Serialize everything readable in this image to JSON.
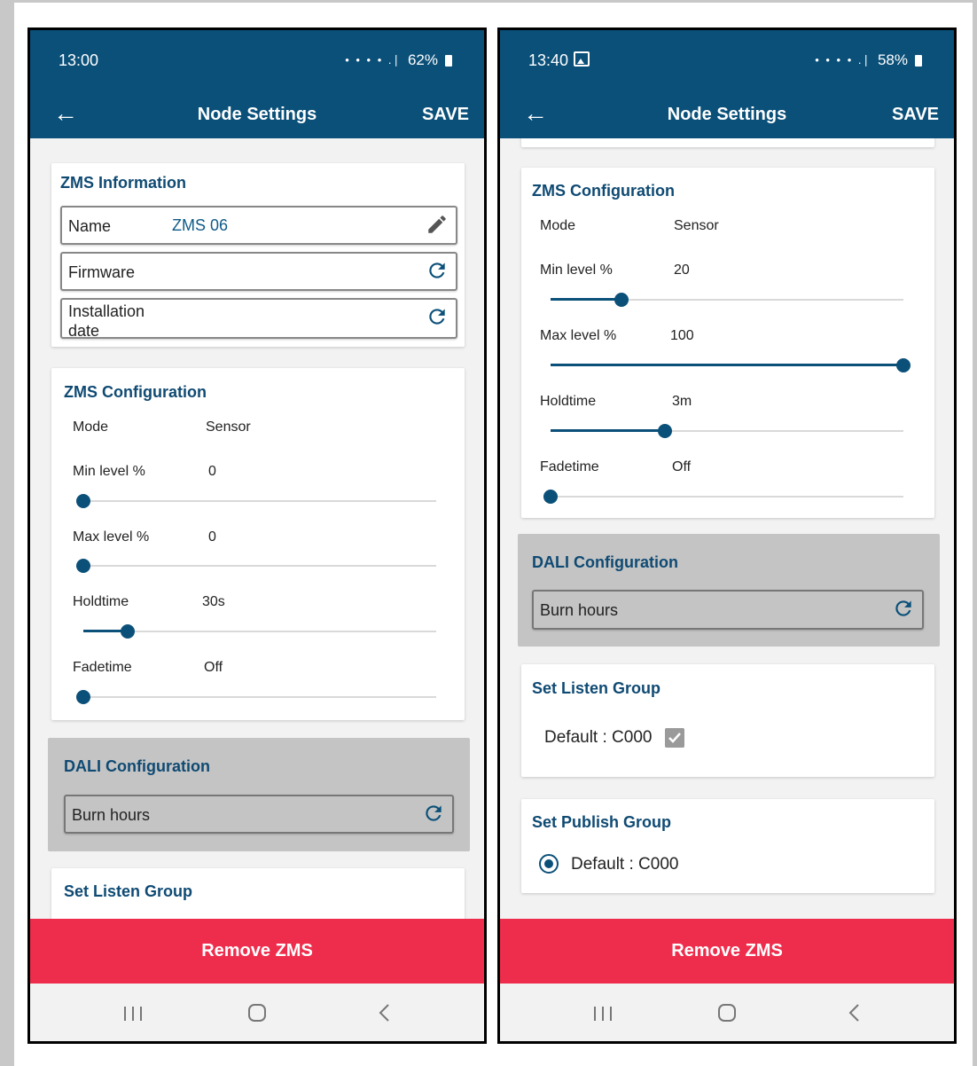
{
  "left": {
    "status": {
      "time": "13:00",
      "battery": "62%",
      "icons": "• • • • .∣"
    },
    "appbar": {
      "title": "Node Settings",
      "save": "SAVE"
    },
    "info": {
      "title": "ZMS Information",
      "name_label": "Name",
      "name_value": "ZMS 06",
      "firmware_label": "Firmware",
      "install_label_1": "Installation",
      "install_label_2": "date"
    },
    "config": {
      "title": "ZMS Configuration",
      "mode_label": "Mode",
      "mode_value": "Sensor",
      "min_label": "Min level %",
      "min_value": "0",
      "min_fraction": 0,
      "max_label": "Max level %",
      "max_value": "0",
      "max_fraction": 0,
      "hold_label": "Holdtime",
      "hold_value": "30s",
      "hold_fraction": 0.125,
      "fade_label": "Fadetime",
      "fade_value": "Off",
      "fade_fraction": 0
    },
    "dali": {
      "title": "DALI Configuration",
      "burn_label": "Burn hours"
    },
    "listen": {
      "title": "Set Listen Group"
    },
    "remove": "Remove ZMS"
  },
  "right": {
    "status": {
      "time": "13:40",
      "battery": "58%",
      "icons": "• • • • .∣"
    },
    "appbar": {
      "title": "Node Settings",
      "save": "SAVE"
    },
    "config": {
      "title": "ZMS Configuration",
      "mode_label": "Mode",
      "mode_value": "Sensor",
      "min_label": "Min level %",
      "min_value": "20",
      "min_fraction": 0.2,
      "max_label": "Max level %",
      "max_value": "100",
      "max_fraction": 1,
      "hold_label": "Holdtime",
      "hold_value": "3m",
      "hold_fraction": 0.325,
      "fade_label": "Fadetime",
      "fade_value": "Off",
      "fade_fraction": 0
    },
    "dali": {
      "title": "DALI Configuration",
      "burn_label": "Burn hours"
    },
    "listen": {
      "title": "Set Listen Group",
      "default": "Default : C000",
      "checked": true
    },
    "publish": {
      "title": "Set Publish Group",
      "default": "Default : C000",
      "selected": true
    },
    "remove": "Remove ZMS"
  },
  "colors": {
    "primary": "#0b5079",
    "title": "#0f4a73",
    "danger": "#ee2d4c",
    "gray_card": "#c4c4c4"
  }
}
